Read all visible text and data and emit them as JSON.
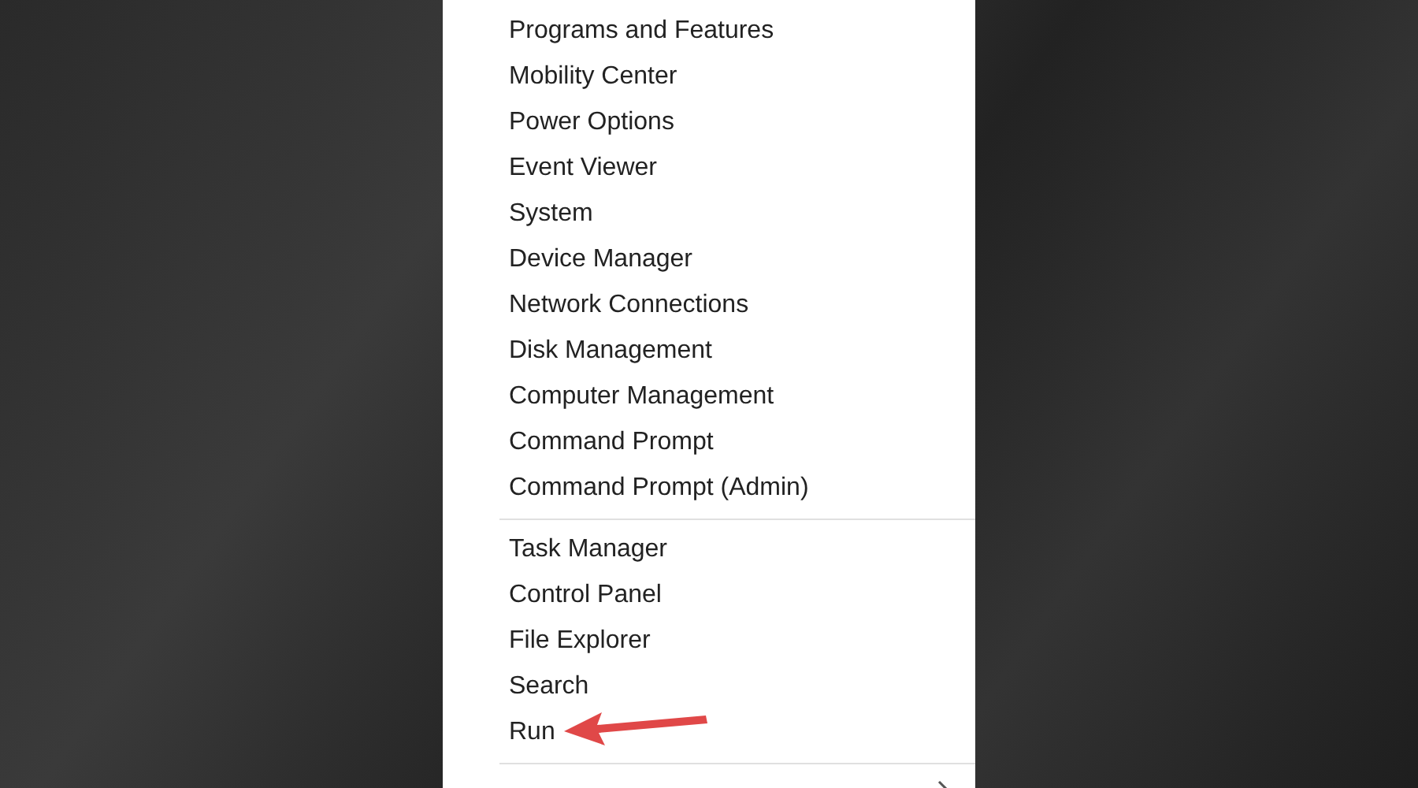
{
  "menu": {
    "groups": [
      {
        "items": [
          {
            "label": "Programs and Features"
          },
          {
            "label": "Mobility Center"
          },
          {
            "label": "Power Options"
          },
          {
            "label": "Event Viewer"
          },
          {
            "label": "System"
          },
          {
            "label": "Device Manager"
          },
          {
            "label": "Network Connections"
          },
          {
            "label": "Disk Management"
          },
          {
            "label": "Computer Management"
          },
          {
            "label": "Command Prompt"
          },
          {
            "label": "Command Prompt (Admin)"
          }
        ]
      },
      {
        "items": [
          {
            "label": "Task Manager"
          },
          {
            "label": "Control Panel"
          },
          {
            "label": "File Explorer"
          },
          {
            "label": "Search"
          },
          {
            "label": "Run"
          }
        ]
      }
    ],
    "cut_off_item": {
      "submenu": true
    }
  },
  "annotation": {
    "kind": "arrow"
  }
}
